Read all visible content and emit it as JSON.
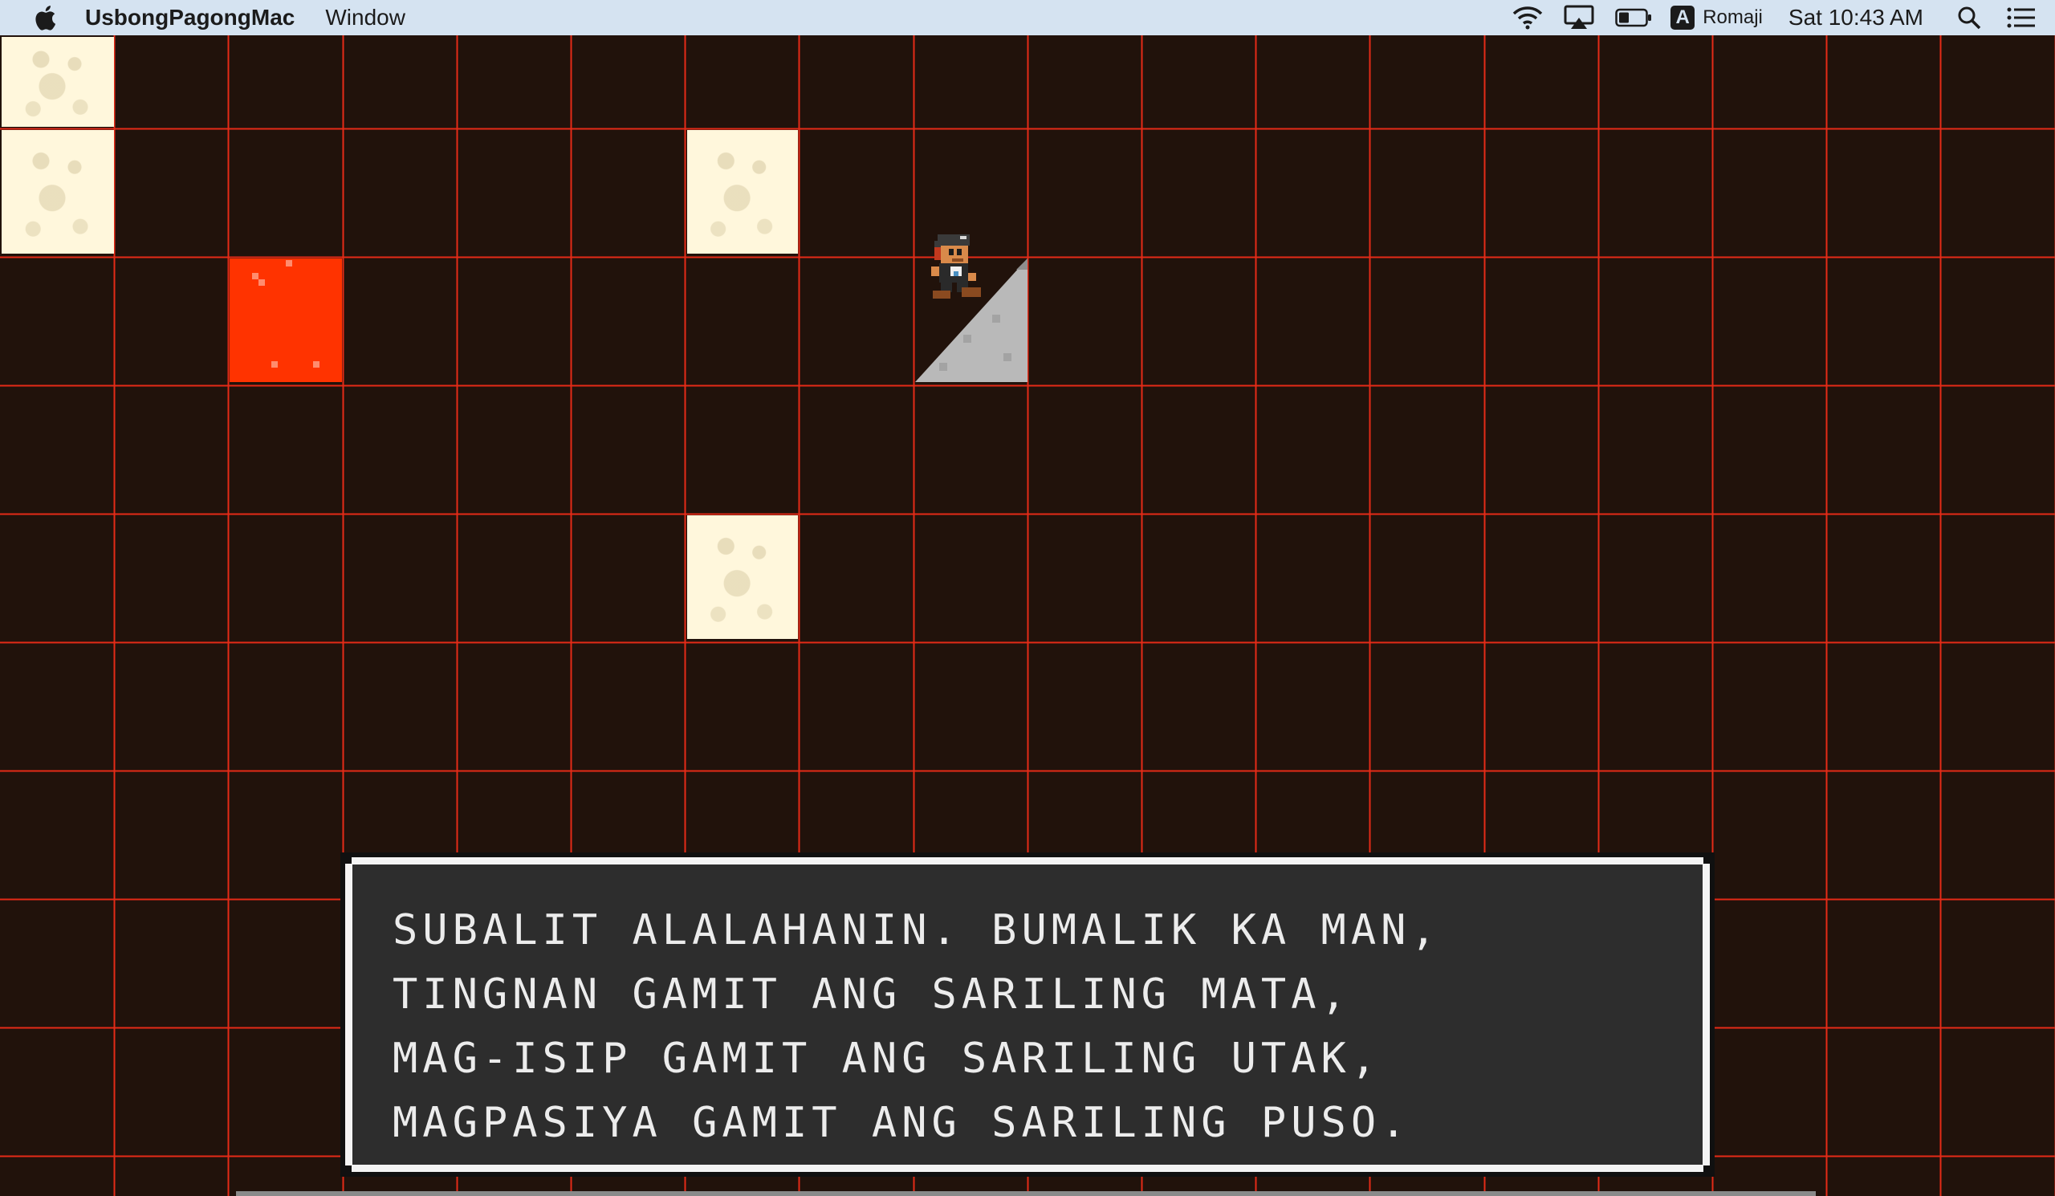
{
  "menubar": {
    "app_name": "UsbongPagongMac",
    "menus": [
      "Window"
    ],
    "input_source_letter": "A",
    "input_source_name": "Romaji",
    "clock": "Sat 10:43 AM"
  },
  "status_icons": [
    "wifi-icon",
    "airplay-icon",
    "battery-icon",
    "input-source-icon",
    "spotlight-search-icon",
    "notification-center-icon"
  ],
  "game": {
    "grid_color": "#e52b17",
    "background_color": "#21120b",
    "tile_colors": {
      "cream": "#fff7dc",
      "red": "#ff3300",
      "slope": "#b9b9b9"
    },
    "dialogue": {
      "lines": [
        "SUBALIT ALALAHANIN. BUMALIK KA MAN,",
        "TINGNAN GAMIT ANG SARILING MATA,",
        "MAG-ISIP GAMIT ANG SARILING UTAK,",
        "MAGPASIYA GAMIT ANG SARILING PUSO."
      ]
    }
  }
}
